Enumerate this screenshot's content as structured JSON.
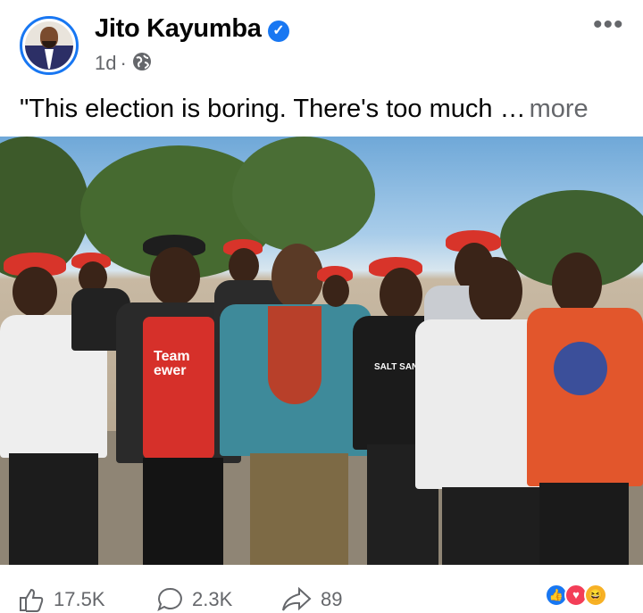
{
  "post": {
    "author_name": "Jito Kayumba",
    "verified_icon": "verified-badge-icon",
    "time_ago": "1d",
    "separator": "·",
    "audience_icon": "globe-icon",
    "menu_label": "•••",
    "text": "\"This election is boring. There's too much",
    "ellipsis": "…",
    "more_label": "more"
  },
  "photo": {
    "shirt_text_1": "Team",
    "shirt_text_2": "ewer",
    "shirt_text_3": "SALT SANA"
  },
  "actions": {
    "like_count": "17.5K",
    "comment_count": "2.3K",
    "share_count": "89"
  },
  "reactions": [
    "like-reaction-icon",
    "love-reaction-icon",
    "haha-reaction-icon"
  ],
  "colors": {
    "accent": "#1877f2",
    "secondary_text": "#65676b",
    "beret_red": "#d8342a"
  }
}
